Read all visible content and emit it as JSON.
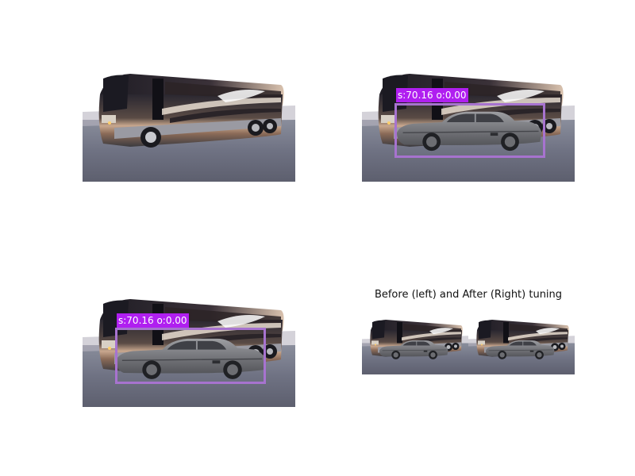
{
  "panels": {
    "top_left": {
      "content": "bus image"
    },
    "top_right": {
      "detection_label": "s:70.16 o:0.00"
    },
    "bottom_left": {
      "detection_label": "s:70.16 o:0.00"
    },
    "bottom_right": {
      "title": "Before (left) and After (Right) tuning"
    }
  },
  "colors": {
    "detection_label_bg": "#b01ff0",
    "detection_box": "#a773cf",
    "background": "#ffffff"
  }
}
